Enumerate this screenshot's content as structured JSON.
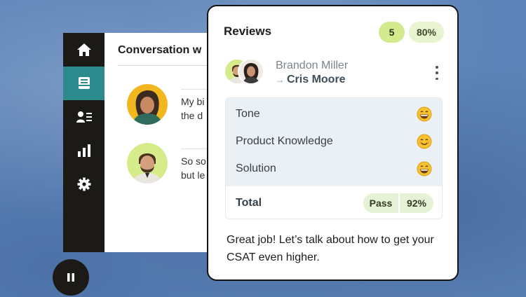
{
  "app": {
    "sidebar": {
      "items": [
        {
          "icon": "home-icon"
        },
        {
          "icon": "inbox-icon",
          "active": true
        },
        {
          "icon": "contacts-icon"
        },
        {
          "icon": "analytics-icon"
        },
        {
          "icon": "settings-icon"
        }
      ],
      "active_color": "#2d8b8d"
    },
    "conversation": {
      "title": "Conversation w",
      "messages": [
        {
          "lines": [
            "My bi",
            "the d"
          ]
        },
        {
          "lines": [
            "So so",
            "but le"
          ]
        }
      ]
    }
  },
  "player": {
    "icon": "pause-icon"
  },
  "reviews": {
    "title": "Reviews",
    "count": "5",
    "average": "80%",
    "agent_name": "Brandon Miller",
    "reviewer_name": "Cris Moore",
    "arrow": "→",
    "criteria": [
      {
        "label": "Tone",
        "icon": "grinning-emoji-icon"
      },
      {
        "label": "Product Knowledge",
        "icon": "smiling-emoji-icon"
      },
      {
        "label": "Solution",
        "icon": "grinning-emoji-icon"
      }
    ],
    "total_label": "Total",
    "total_status": "Pass",
    "total_score": "92%",
    "feedback": "Great job! Let’s talk about how to get your CSAT even higher.",
    "colors": {
      "accent_green": "#d3ea8e",
      "light_green": "#e8f3d0",
      "criteria_bg": "#ebf0f5"
    }
  }
}
